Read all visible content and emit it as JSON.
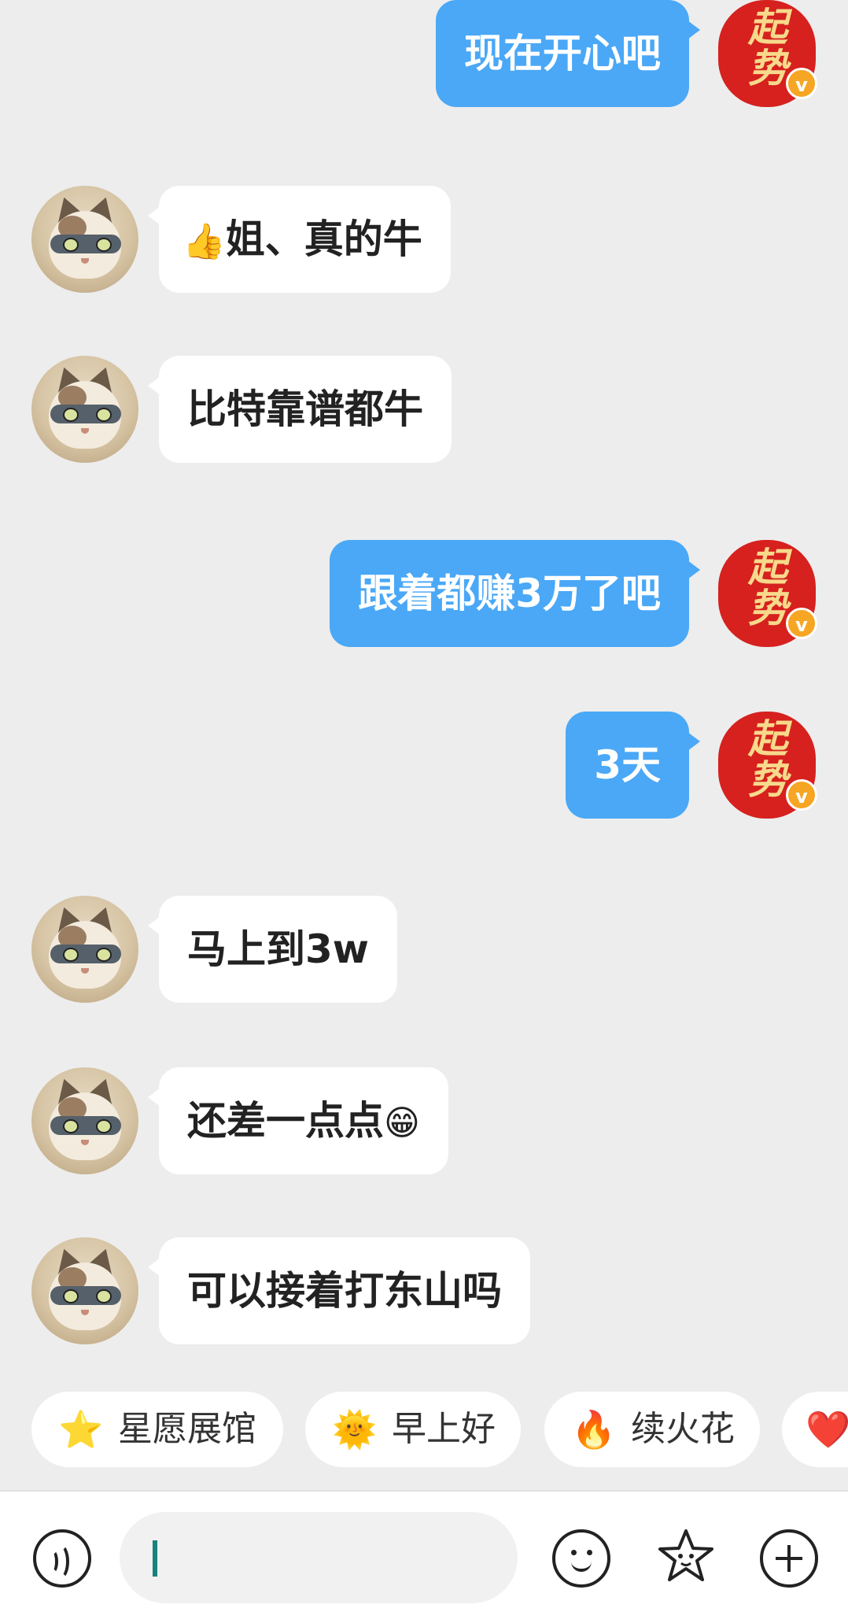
{
  "messages": [
    {
      "side": "right",
      "text": "现在开心吧"
    },
    {
      "side": "left",
      "emoji": "👍",
      "text": "姐、真的牛"
    },
    {
      "side": "left",
      "text": "比特靠谱都牛"
    },
    {
      "side": "right",
      "text": "跟着都赚3万了吧"
    },
    {
      "side": "right",
      "text": "3天"
    },
    {
      "side": "left",
      "text": "马上到3w"
    },
    {
      "side": "left",
      "text": "还差一点点",
      "emoji": "😁"
    },
    {
      "side": "left",
      "text": "可以接着打东山吗"
    }
  ],
  "self_avatar": {
    "char1": "起",
    "char2": "势",
    "badge": "v"
  },
  "quick_chips": [
    {
      "icon": "⭐",
      "label": "星愿展馆"
    },
    {
      "icon": "🌞",
      "label": "早上好"
    },
    {
      "icon": "🔥",
      "label": "续火花"
    },
    {
      "icon": "❤️",
      "label": ""
    }
  ],
  "input": {
    "value": ""
  },
  "colors": {
    "bubble_self": "#4AA8F6",
    "bubble_other": "#FFFFFF",
    "background": "#EDEDED",
    "caret": "#17837A"
  }
}
